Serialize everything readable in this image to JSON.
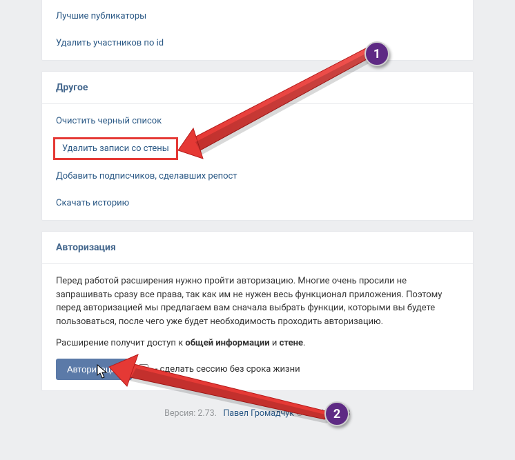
{
  "topLinks": {
    "items": [
      {
        "label": "Лучшие публикаторы"
      },
      {
        "label": "Удалить участников по id"
      }
    ]
  },
  "otherSection": {
    "title": "Другое",
    "items": [
      {
        "label": "Очистить черный список"
      },
      {
        "label": "Удалить записи со стены",
        "highlighted": true
      },
      {
        "label": "Добавить подписчиков, сделавших репост"
      },
      {
        "label": "Скачать историю"
      }
    ]
  },
  "authSection": {
    "title": "Авторизация",
    "paragraph1": "Перед работой расширения нужно пройти авторизацию. Многие очень просили не запрашивать сразу все права, так как им не нужен весь функционал приложения. Поэтому перед авторизацией мы предлагаем вам сначала выбрать функции, которыми вы будете пользоваться, после чего уже будет необходимость проходить авторизацию.",
    "paragraph2_prefix": "Расширение получит доступ к ",
    "paragraph2_bold1": "общей информации",
    "paragraph2_mid": " и ",
    "paragraph2_bold2": "стене",
    "paragraph2_suffix": ".",
    "buttonLabel": "Авторизация",
    "checkboxLabel": "- сделать сессию без срока жизни"
  },
  "footer": {
    "versionPrefix": "Версия: ",
    "version": "2.73.",
    "authorPrefix": " ",
    "author": "Павел Громадчук",
    "copyright": " © 2016 - 2018"
  },
  "annotations": {
    "badge1": "1",
    "badge2": "2"
  }
}
